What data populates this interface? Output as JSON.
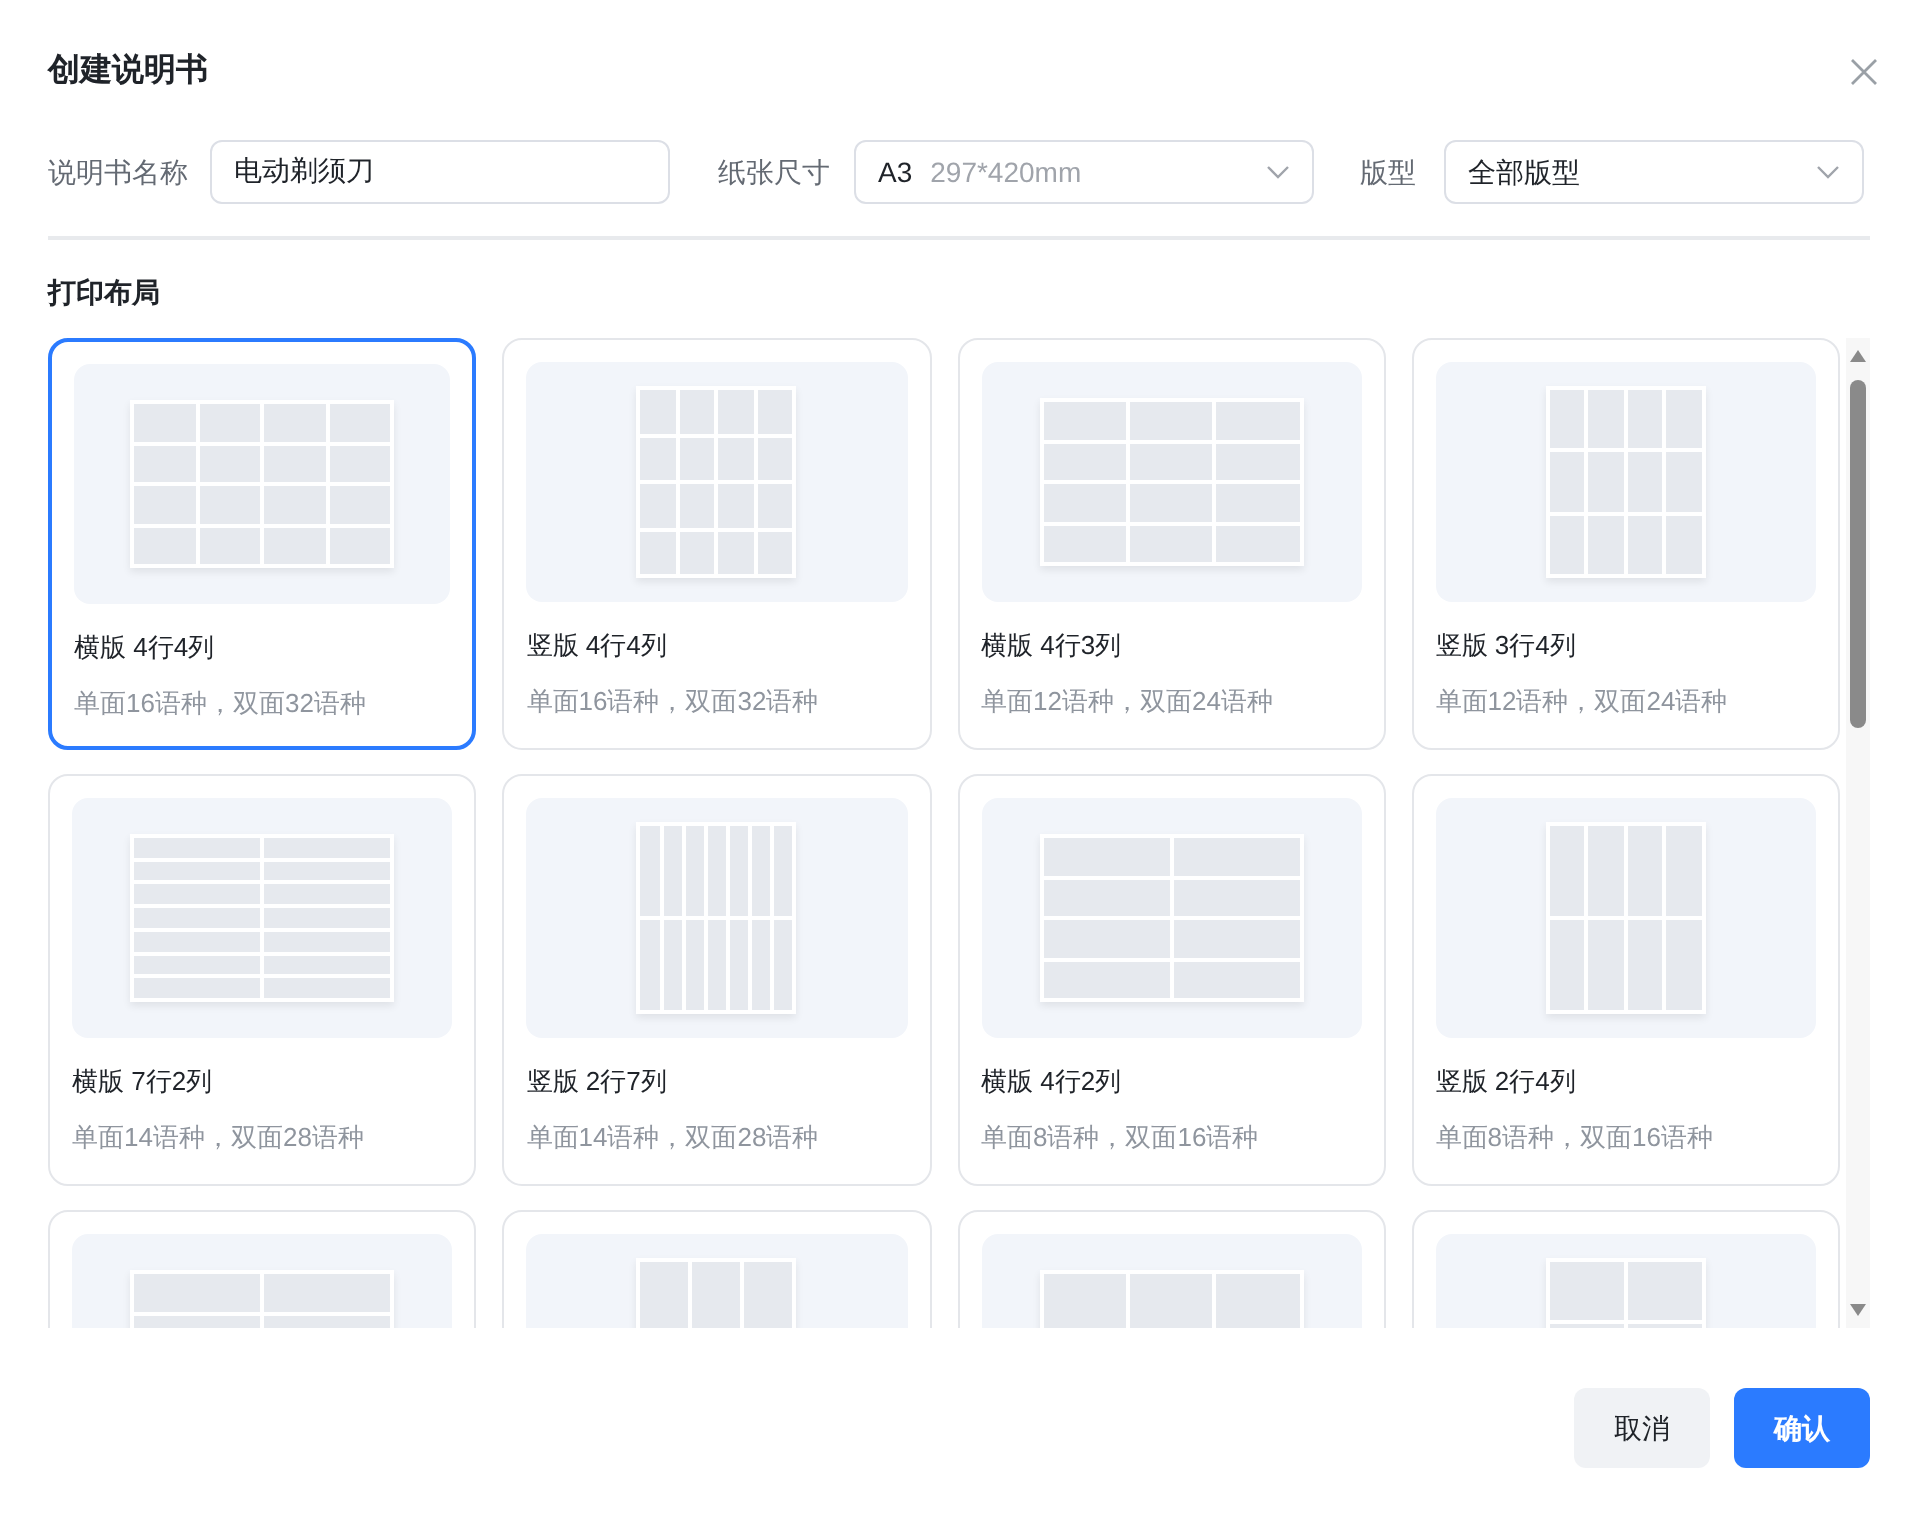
{
  "dialog": {
    "title": "创建说明书"
  },
  "form": {
    "name_label": "说明书名称",
    "name_value": "电动剃须刀",
    "paper_label": "纸张尺寸",
    "paper_size": "A3",
    "paper_dims": "297*420mm",
    "layout_label": "版型",
    "layout_value": "全部版型"
  },
  "section_title": "打印布局",
  "layouts": [
    {
      "title": "横版 4行4列",
      "subtitle": "单面16语种，双面32语种",
      "selected": true
    },
    {
      "title": "竖版 4行4列",
      "subtitle": "单面16语种，双面32语种",
      "selected": false
    },
    {
      "title": "横版 4行3列",
      "subtitle": "单面12语种，双面24语种",
      "selected": false
    },
    {
      "title": "竖版 3行4列",
      "subtitle": "单面12语种，双面24语种",
      "selected": false
    },
    {
      "title": "横版 7行2列",
      "subtitle": "单面14语种，双面28语种",
      "selected": false
    },
    {
      "title": "竖版 2行7列",
      "subtitle": "单面14语种，双面28语种",
      "selected": false
    },
    {
      "title": "横版 4行2列",
      "subtitle": "单面8语种，双面16语种",
      "selected": false
    },
    {
      "title": "竖版 2行4列",
      "subtitle": "单面8语种，双面16语种",
      "selected": false
    },
    {
      "selected": false
    },
    {
      "selected": false
    },
    {
      "selected": false
    },
    {
      "selected": false
    }
  ],
  "buttons": {
    "cancel": "取消",
    "confirm": "确认"
  }
}
